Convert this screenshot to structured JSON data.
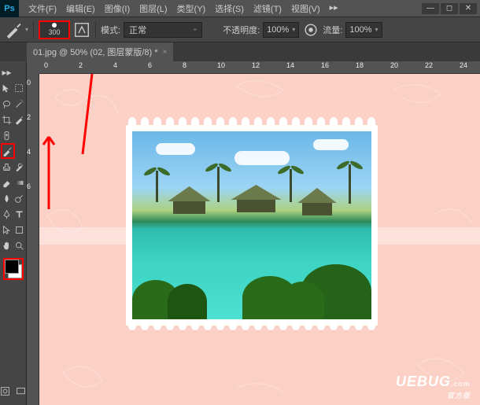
{
  "menubar": {
    "logo": "Ps",
    "items": [
      "文件(F)",
      "编辑(E)",
      "图像(I)",
      "图层(L)",
      "类型(Y)",
      "选择(S)",
      "滤镜(T)",
      "视图(V)"
    ]
  },
  "options": {
    "brush_size": "300",
    "mode_label": "模式:",
    "mode_value": "正常",
    "opacity_label": "不透明度:",
    "opacity_value": "100%",
    "flow_label": "流量:",
    "flow_value": "100%"
  },
  "tab": {
    "title": "01.jpg @ 50% (02, 图层蒙版/8) *"
  },
  "ruler": {
    "h": [
      "0",
      "2",
      "4",
      "6",
      "8",
      "10",
      "12",
      "14",
      "16",
      "18",
      "20",
      "22",
      "24"
    ],
    "v": [
      "0",
      "2",
      "4",
      "6"
    ]
  },
  "watermark": {
    "brand": "UEBUG",
    "suffix": ".com",
    "tag": "官方版"
  }
}
